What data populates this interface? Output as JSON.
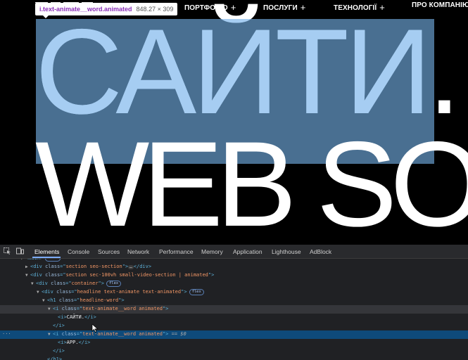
{
  "nav": {
    "items": [
      {
        "label": "ПОРТФОЛІО",
        "plus": "+"
      },
      {
        "label": "ПОСЛУГИ",
        "plus": "+"
      },
      {
        "label": "ТЕХНОЛОГІЇ",
        "plus": "+"
      },
      {
        "label": "ПРО КОМПАНІЮ",
        "plus": ""
      }
    ]
  },
  "hero": {
    "line1": "САЙТИ. A",
    "line2": "WEB SO"
  },
  "tooltip": {
    "selector": "i.text-animate__word.animated",
    "dimensions": "848.27 × 309"
  },
  "devtools": {
    "tabs": [
      "Elements",
      "Console",
      "Sources",
      "Network",
      "Performance",
      "Memory",
      "Application",
      "Lighthouse",
      "AdBlock"
    ],
    "active_tab": "Elements",
    "dom_lines": [
      {
        "kind": "open",
        "tag": "main",
        "badge": "flex",
        "text": "",
        "partial": true
      },
      {
        "kind": "collapsed",
        "tag": "div",
        "cls": "section seo-section",
        "ellipsis": "…"
      },
      {
        "kind": "open",
        "tag": "div",
        "cls": "section sec-100vh small-video-section | animated"
      },
      {
        "kind": "open",
        "tag": "div",
        "cls": "container",
        "badge": "flex"
      },
      {
        "kind": "open",
        "tag": "div",
        "cls": "headline text-animate text-animated",
        "badge": "flex"
      },
      {
        "kind": "open",
        "tag": "h1",
        "cls": "headline-word"
      },
      {
        "kind": "open",
        "tag": "i",
        "cls": "text-animate__word animated"
      },
      {
        "kind": "inner",
        "tag": "i",
        "text": "САЙТИ."
      },
      {
        "kind": "close",
        "tag": "i"
      },
      {
        "kind": "open",
        "tag": "i",
        "cls": "text-animate__word animated",
        "marker": "== $0"
      },
      {
        "kind": "inner",
        "tag": "i",
        "text": "APP."
      },
      {
        "kind": "close",
        "tag": "i"
      },
      {
        "kind": "close",
        "tag": "h1"
      }
    ]
  }
}
